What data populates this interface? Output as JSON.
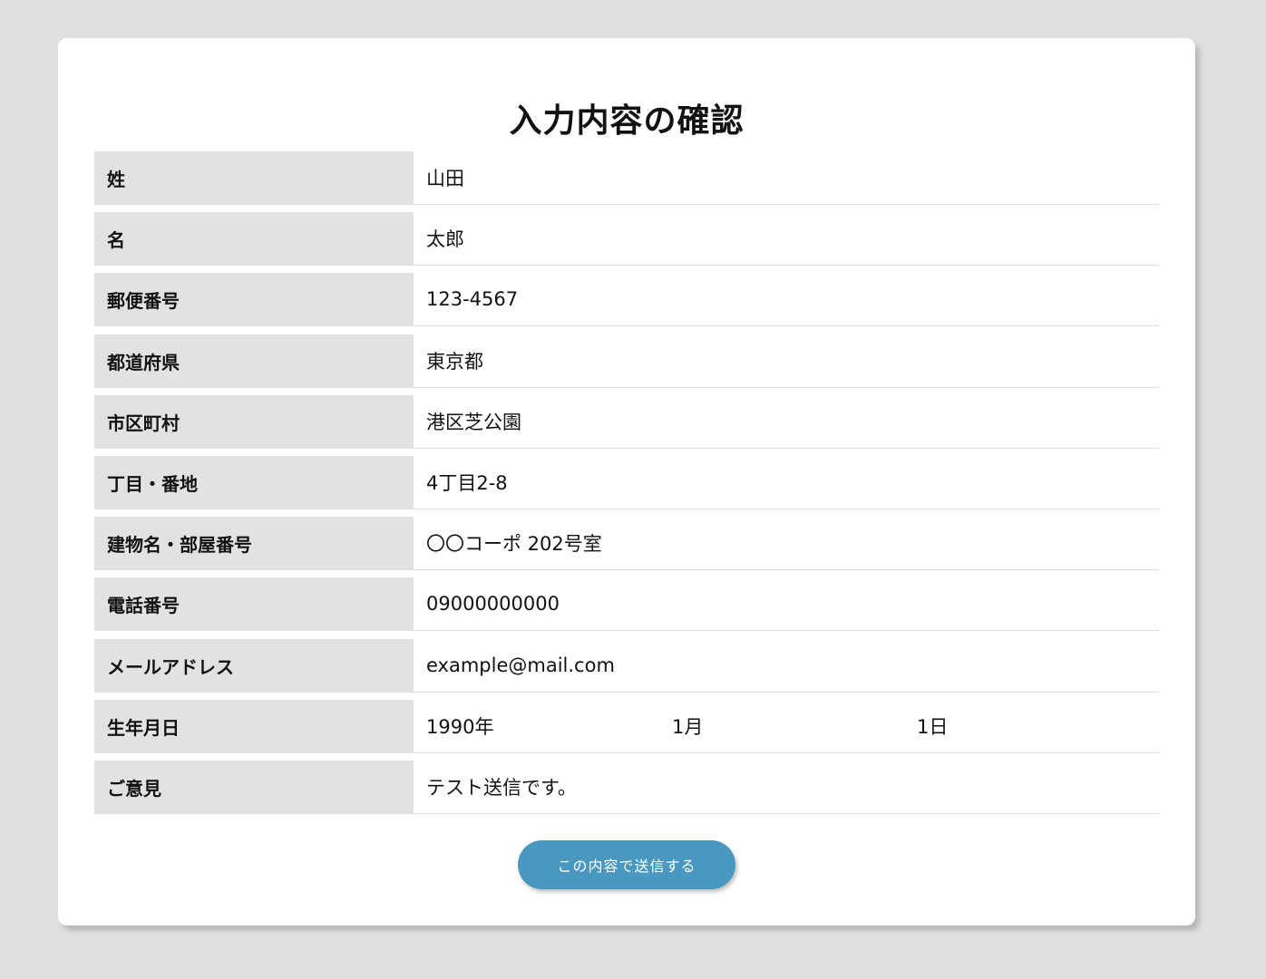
{
  "page": {
    "title": "入力内容の確認"
  },
  "fields": [
    {
      "label": "姓",
      "value": "山田"
    },
    {
      "label": "名",
      "value": "太郎"
    },
    {
      "label": "郵便番号",
      "value": "123-4567"
    },
    {
      "label": "都道府県",
      "value": "東京都"
    },
    {
      "label": "市区町村",
      "value": "港区芝公園"
    },
    {
      "label": "丁目・番地",
      "value": "4丁目2-8"
    },
    {
      "label": "建物名・部屋番号",
      "value": "〇〇コーポ 202号室"
    },
    {
      "label": "電話番号",
      "value": "09000000000"
    },
    {
      "label": "メールアドレス",
      "value": "example@mail.com"
    }
  ],
  "birthdate": {
    "label": "生年月日",
    "year": "1990年",
    "month": "1月",
    "day": "1日"
  },
  "comment": {
    "label": "ご意見",
    "value": "テスト送信です。"
  },
  "actions": {
    "submit_label": "この内容で送信する"
  },
  "colors": {
    "background": "#e0e0e0",
    "card": "#ffffff",
    "label_bg": "#e2e2e2",
    "button": "#4a98c0"
  }
}
